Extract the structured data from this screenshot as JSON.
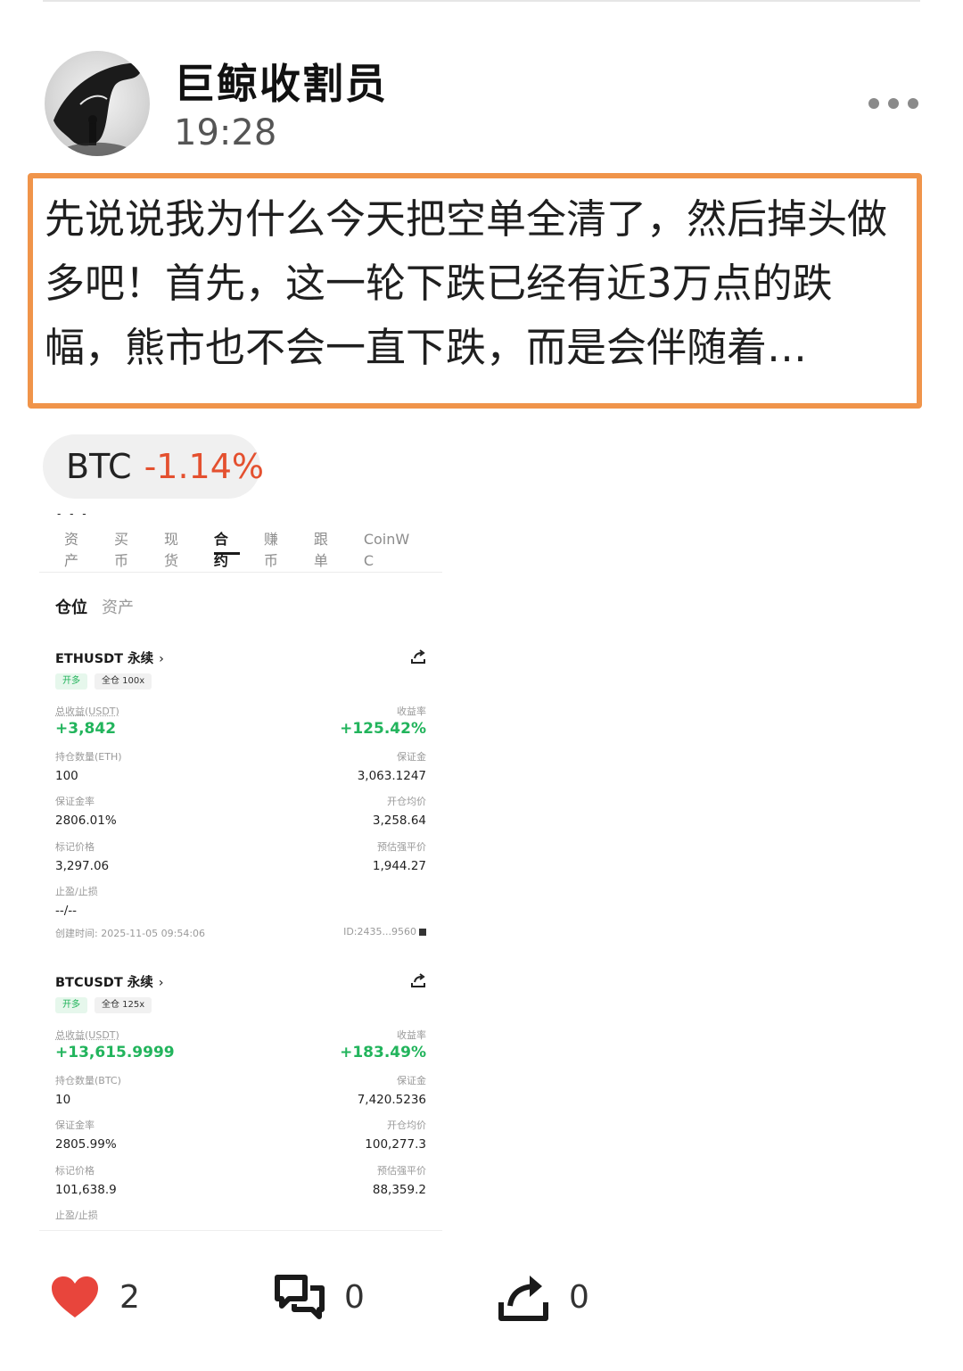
{
  "post": {
    "username": "巨鲸收割员",
    "time": "19:28",
    "text": "先说说我为什么今天把空单全清了，然后掉头做多吧！首先，这一轮下跌已经有近3万点的跌幅，熊市也不会一直下跌，而是会伴随着…"
  },
  "coin_chip": {
    "symbol": "BTC",
    "change": "-1.14%",
    "change_color": "#e4502f"
  },
  "screenshot": {
    "tabs": [
      "资产",
      "买币",
      "现货",
      "合约",
      "赚币",
      "跟单",
      "CoinW C"
    ],
    "active_tab": "合约",
    "subtabs": [
      "仓位",
      "资产"
    ],
    "positions": [
      {
        "pair": "ETHUSDT 永续",
        "side": "开多",
        "leverage": "全仓 100x",
        "pnl_label": "总收益(USDT)",
        "pnl": "+3,842",
        "roe_label": "收益率",
        "roe": "+125.42%",
        "qty_label": "持仓数量(ETH)",
        "qty": "100",
        "margin_label": "保证金",
        "margin": "3,063.1247",
        "margin_ratio_label": "保证金率",
        "margin_ratio": "2806.01%",
        "entry_label": "开仓均价",
        "entry": "3,258.64",
        "mark_label": "标记价格",
        "mark": "3,297.06",
        "liq_label": "预估强平价",
        "liq": "1,944.27",
        "tpsl_label": "止盈/止损",
        "tpsl": "--/--",
        "created": "创建时间: 2025-11-05 09:54:06",
        "id": "ID:2435...9560"
      },
      {
        "pair": "BTCUSDT 永续",
        "side": "开多",
        "leverage": "全仓 125x",
        "pnl_label": "总收益(USDT)",
        "pnl": "+13,615.9999",
        "roe_label": "收益率",
        "roe": "+183.49%",
        "qty_label": "持仓数量(BTC)",
        "qty": "10",
        "margin_label": "保证金",
        "margin": "7,420.5236",
        "margin_ratio_label": "保证金率",
        "margin_ratio": "2805.99%",
        "entry_label": "开仓均价",
        "entry": "100,277.3",
        "mark_label": "标记价格",
        "mark": "101,638.9",
        "liq_label": "预估强平价",
        "liq": "88,359.2",
        "tpsl_label": "止盈/止损"
      }
    ]
  },
  "actions": {
    "likes": "2",
    "comments": "0",
    "reposts": "0",
    "like_color": "#e8453c",
    "icons": [
      "heart-icon",
      "comment-icon",
      "repost-icon"
    ]
  }
}
